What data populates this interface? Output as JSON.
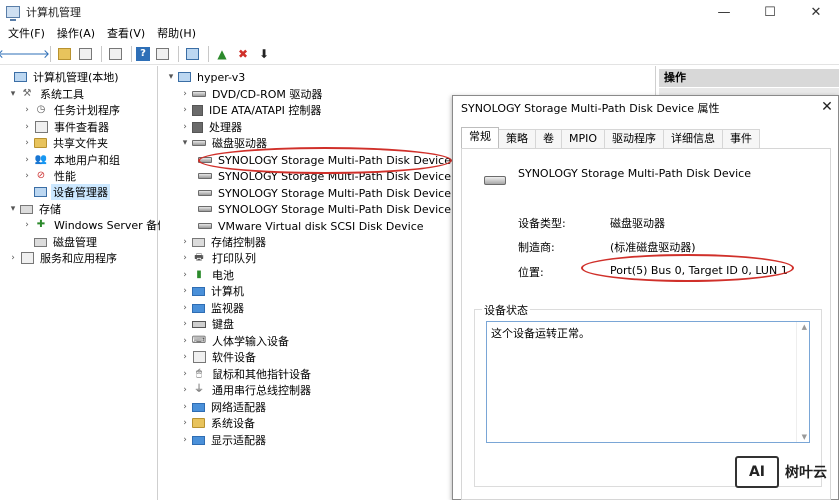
{
  "window": {
    "title": "计算机管理",
    "controls": {
      "minimize": "—",
      "maximize": "☐",
      "close": "✕"
    }
  },
  "menu": [
    "文件(F)",
    "操作(A)",
    "查看(V)",
    "帮助(H)"
  ],
  "toolbar": {
    "back": "🡐",
    "forward": "🡒",
    "up": "▲",
    "help": "?",
    "delete": "✖",
    "download": "⬇"
  },
  "left_tree": [
    {
      "label": "计算机管理(本地)",
      "depth": 0,
      "arrow": ""
    },
    {
      "label": "系统工具",
      "depth": 1,
      "arrow": "▾"
    },
    {
      "label": "任务计划程序",
      "depth": 2,
      "arrow": "›"
    },
    {
      "label": "事件查看器",
      "depth": 2,
      "arrow": "›"
    },
    {
      "label": "共享文件夹",
      "depth": 2,
      "arrow": "›"
    },
    {
      "label": "本地用户和组",
      "depth": 2,
      "arrow": "›"
    },
    {
      "label": "性能",
      "depth": 2,
      "arrow": "›"
    },
    {
      "label": "设备管理器",
      "depth": 2,
      "arrow": ""
    },
    {
      "label": "存储",
      "depth": 1,
      "arrow": "▾"
    },
    {
      "label": "Windows Server 备份",
      "depth": 2,
      "arrow": "›"
    },
    {
      "label": "磁盘管理",
      "depth": 2,
      "arrow": ""
    },
    {
      "label": "服务和应用程序",
      "depth": 1,
      "arrow": "›"
    }
  ],
  "device_tree": {
    "root": "hyper-v3",
    "items": [
      {
        "label": "DVD/CD-ROM 驱动器",
        "arrow": "›"
      },
      {
        "label": "IDE ATA/ATAPI 控制器",
        "arrow": "›"
      },
      {
        "label": "处理器",
        "arrow": "›"
      },
      {
        "label": "磁盘驱动器",
        "arrow": "▾"
      },
      {
        "label": "SYNOLOGY Storage  Multi-Path Disk Device",
        "arrow": "",
        "child": true
      },
      {
        "label": "SYNOLOGY Storage  Multi-Path Disk Device",
        "arrow": "",
        "child": true
      },
      {
        "label": "SYNOLOGY Storage  Multi-Path Disk Device",
        "arrow": "",
        "child": true
      },
      {
        "label": "SYNOLOGY Storage  Multi-Path Disk Device",
        "arrow": "",
        "child": true
      },
      {
        "label": "VMware Virtual disk SCSI Disk Device",
        "arrow": "",
        "child": true
      },
      {
        "label": "存储控制器",
        "arrow": "›"
      },
      {
        "label": "打印队列",
        "arrow": "›"
      },
      {
        "label": "电池",
        "arrow": "›"
      },
      {
        "label": "计算机",
        "arrow": "›"
      },
      {
        "label": "监视器",
        "arrow": "›"
      },
      {
        "label": "键盘",
        "arrow": "›"
      },
      {
        "label": "人体学输入设备",
        "arrow": "›"
      },
      {
        "label": "软件设备",
        "arrow": "›"
      },
      {
        "label": "鼠标和其他指针设备",
        "arrow": "›"
      },
      {
        "label": "通用串行总线控制器",
        "arrow": "›"
      },
      {
        "label": "网络适配器",
        "arrow": "›"
      },
      {
        "label": "系统设备",
        "arrow": "›"
      },
      {
        "label": "显示适配器",
        "arrow": "›"
      }
    ]
  },
  "actions_pane": {
    "header": "操作"
  },
  "dialog": {
    "title": "SYNOLOGY Storage  Multi-Path Disk Device 属性",
    "close": "✕",
    "tabs": [
      "常规",
      "策略",
      "卷",
      "MPIO",
      "驱动程序",
      "详细信息",
      "事件"
    ],
    "device_name": "SYNOLOGY Storage  Multi-Path Disk Device",
    "props": {
      "type_label": "设备类型:",
      "type_value": "磁盘驱动器",
      "mfr_label": "制造商:",
      "mfr_value": "(标准磁盘驱动器)",
      "loc_label": "位置:",
      "loc_value": "Port(5) Bus 0, Target ID 0, LUN 1"
    },
    "status_group": "设备状态",
    "status_text": "这个设备运转正常。"
  },
  "watermark": {
    "logo": "AI",
    "text": "树叶云"
  },
  "colors": {
    "highlight": "#d0302a",
    "selection": "#cce8ff",
    "accent": "#7aa6d6"
  }
}
